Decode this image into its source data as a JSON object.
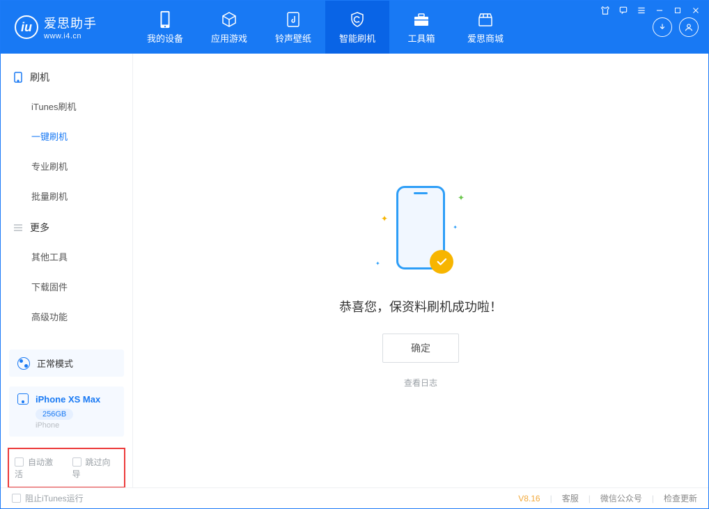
{
  "app": {
    "name": "爱思助手",
    "url": "www.i4.cn"
  },
  "tabs": {
    "device": "我的设备",
    "apps": "应用游戏",
    "ringtone": "铃声壁纸",
    "flash": "智能刷机",
    "toolbox": "工具箱",
    "store": "爱思商城"
  },
  "sidebar": {
    "group_flash": "刷机",
    "items_flash": [
      "iTunes刷机",
      "一键刷机",
      "专业刷机",
      "批量刷机"
    ],
    "group_more": "更多",
    "items_more": [
      "其他工具",
      "下载固件",
      "高级功能"
    ]
  },
  "mode": {
    "label": "正常模式"
  },
  "device": {
    "name": "iPhone XS Max",
    "capacity": "256GB",
    "type": "iPhone"
  },
  "checks": {
    "auto_activate": "自动激活",
    "skip_guide": "跳过向导"
  },
  "main": {
    "success": "恭喜您，保资料刷机成功啦！",
    "ok": "确定",
    "view_log": "查看日志"
  },
  "footer": {
    "block_itunes": "阻止iTunes运行",
    "version": "V8.16",
    "support": "客服",
    "wechat": "微信公众号",
    "update": "检查更新"
  }
}
